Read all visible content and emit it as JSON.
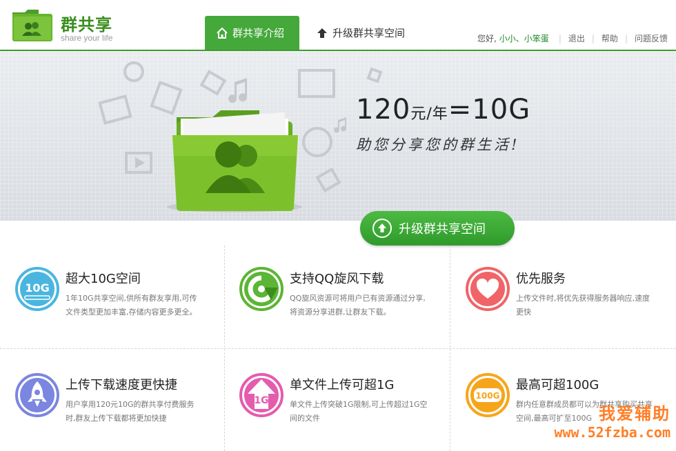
{
  "logo": {
    "title": "群共享",
    "subtitle": "share your life"
  },
  "tabs": [
    {
      "label": "群共享介绍",
      "icon": "home-icon",
      "active": true
    },
    {
      "label": "升级群共享空间",
      "icon": "upload-arrow-icon",
      "active": false
    }
  ],
  "userbar": {
    "greeting": "您好,",
    "username": "小小、小笨蛋",
    "logout": "退出",
    "help": "帮助",
    "feedback": "问题反馈"
  },
  "banner": {
    "price_amount": "120",
    "price_unit": "元/年",
    "price_eq": "=",
    "price_space": "10G",
    "slogan": "助您分享您的群生活!"
  },
  "upgrade_button": {
    "label": "升级群共享空间"
  },
  "features": [
    {
      "title": "超大10G空间",
      "desc": "1年10G共享空间,供所有群友享用,可传文件类型更加丰富,存储内容更多更全。",
      "icon": "10g-storage-icon",
      "color": "#4ab6e0",
      "icon_text": "10G"
    },
    {
      "title": "支持QQ旋风下载",
      "desc": "QQ旋风资源可将用户已有资源通过分享,将资源分享进群,让群友下载。",
      "icon": "qq-whirlwind-icon",
      "color": "#5cb535",
      "icon_text": ""
    },
    {
      "title": "优先服务",
      "desc": "上传文件时,将优先获得服务器响应,速度更快",
      "icon": "heart-icon",
      "color": "#f06468",
      "icon_text": ""
    },
    {
      "title": "上传下载速度更快捷",
      "desc": "用户享用120元10G的群共享付费服务时,群友上传下载都将更加快捷",
      "icon": "rocket-icon",
      "color": "#7b86e0",
      "icon_text": ""
    },
    {
      "title": "单文件上传可超1G",
      "desc": "单文件上传突破1G限制,可上传超过1G空间的文件",
      "icon": "1g-upload-icon",
      "color": "#e45cae",
      "icon_text": "1G"
    },
    {
      "title": "最高可超100G",
      "desc": "群内任意群成员都可以为群共享购买共享空间,最高可扩至100G",
      "icon": "100g-icon",
      "color": "#f6a51b",
      "icon_text": "100G"
    }
  ],
  "watermark": {
    "line1": "我爱辅助",
    "line2": "www.52fzba.com"
  }
}
